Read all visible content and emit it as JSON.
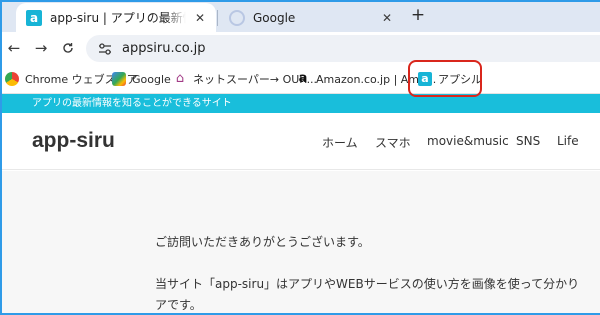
{
  "tabs": [
    {
      "title": "app-siru | アプリの最新情報を知る",
      "icon": "appsiru-favicon-icon",
      "active": true
    },
    {
      "title": "Google",
      "icon": "google-favicon-icon",
      "active": false
    }
  ],
  "new_tab_label": "+",
  "toolbar": {
    "back_icon": "←",
    "forward_icon": "→",
    "reload_icon": "C",
    "site_info_icon": "⊶",
    "url": "appsiru.co.jp"
  },
  "bookmarks": [
    {
      "label": "Chrome ウェブストア",
      "icon": "chrome-webstore-icon"
    },
    {
      "label": "Google",
      "icon": "google-icon"
    },
    {
      "label": "ネットスーパー→ OUR...",
      "icon": "house-icon"
    },
    {
      "label": "Amazon.co.jp | Ama...",
      "icon": "amazon-icon"
    },
    {
      "label": "アプシル",
      "icon": "appsiru-icon"
    }
  ],
  "site": {
    "banner": "アプリの最新情報を知ることができるサイト",
    "logo": "app-siru",
    "nav": [
      "ホーム",
      "スマホ",
      "movie&music",
      "SNS",
      "Life"
    ],
    "paragraphs": [
      "ご訪問いただきありがとうございます。",
      "当サイト「app-siru」はアプリやWEBサービスの使い方を画像を使って分かり",
      "アです。"
    ]
  },
  "colors": {
    "accent": "#19bedb",
    "highlight": "#d9261c",
    "tabstrip": "#dfe7f3",
    "frame": "#2f9be8"
  }
}
